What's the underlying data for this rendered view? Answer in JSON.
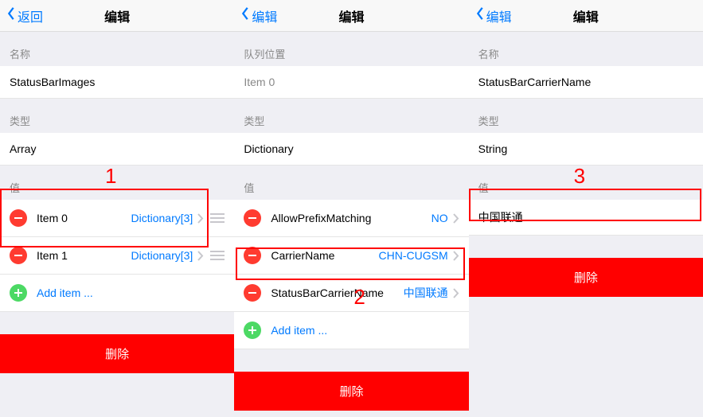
{
  "col1": {
    "back": "返回",
    "title": "编辑",
    "nameHdr": "名称",
    "nameVal": "StatusBarImages",
    "typeHdr": "类型",
    "typeVal": "Array",
    "valueHdr": "值",
    "items": [
      {
        "label": "Item 0",
        "value": "Dictionary[3]"
      },
      {
        "label": "Item 1",
        "value": "Dictionary[3]"
      }
    ],
    "addItem": "Add item ...",
    "delete": "删除",
    "anno": "1"
  },
  "col2": {
    "back": "编辑",
    "title": "编辑",
    "posHdr": "队列位置",
    "posVal": "Item 0",
    "typeHdr": "类型",
    "typeVal": "Dictionary",
    "valueHdr": "值",
    "items": [
      {
        "label": "AllowPrefixMatching",
        "value": "NO"
      },
      {
        "label": "CarrierName",
        "value": "CHN-CUGSM"
      },
      {
        "label": "StatusBarCarrierName",
        "value": "中国联通"
      }
    ],
    "addItem": "Add item ...",
    "delete": "删除",
    "anno": "2"
  },
  "col3": {
    "back": "编辑",
    "title": "编辑",
    "nameHdr": "名称",
    "nameVal": "StatusBarCarrierName",
    "typeHdr": "类型",
    "typeVal": "String",
    "valueHdr": "值",
    "input": "中国联通",
    "delete": "删除",
    "anno": "3"
  }
}
